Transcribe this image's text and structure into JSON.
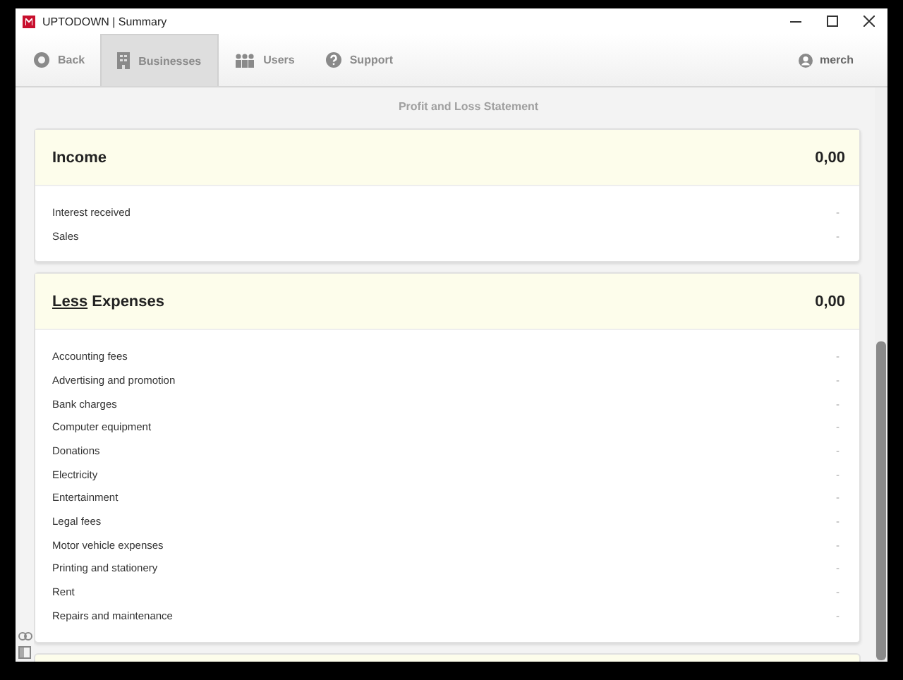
{
  "window": {
    "title": "UPTODOWN | Summary"
  },
  "nav": [
    {
      "label": "Back",
      "kind": "back",
      "selected": false
    },
    {
      "label": "Businesses",
      "kind": "building",
      "selected": true
    },
    {
      "label": "Users",
      "kind": "users",
      "selected": false
    },
    {
      "label": "Support",
      "kind": "help",
      "selected": false
    }
  ],
  "user": {
    "name": "merch"
  },
  "statement": {
    "title": "Profit and Loss Statement"
  },
  "sections": [
    {
      "title": "Income",
      "total": "0,00",
      "rows": [
        {
          "label": "Interest received",
          "value": "-"
        },
        {
          "label": "Sales",
          "value": "-"
        }
      ]
    },
    {
      "title_underlined": "Less",
      "title": "Expenses",
      "total": "0,00",
      "rows": [
        {
          "label": "Accounting fees",
          "value": "-"
        },
        {
          "label": "Advertising and promotion",
          "value": "-"
        },
        {
          "label": "Bank charges",
          "value": "-"
        },
        {
          "label": "Computer equipment",
          "value": "-"
        },
        {
          "label": "Donations",
          "value": "-"
        },
        {
          "label": "Electricity",
          "value": "-"
        },
        {
          "label": "Entertainment",
          "value": "-"
        },
        {
          "label": "Legal fees",
          "value": "-"
        },
        {
          "label": "Motor vehicle expenses",
          "value": "-"
        },
        {
          "label": "Printing and stationery",
          "value": "-"
        },
        {
          "label": "Rent",
          "value": "-"
        },
        {
          "label": "Repairs and maintenance",
          "value": "-"
        }
      ]
    }
  ]
}
